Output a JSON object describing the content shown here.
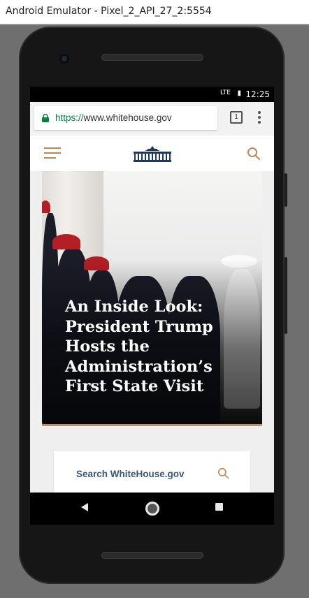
{
  "window": {
    "title": "Android Emulator - Pixel_2_API_27_2:5554"
  },
  "status_bar": {
    "network": "LTE",
    "time": "12:25"
  },
  "browser": {
    "url_scheme": "https://",
    "url_host": "www.whitehouse.gov",
    "tab_count": "1"
  },
  "site": {
    "hero_headline": "An Inside Look: President Trump Hosts the Administration’s First State Visit",
    "search_label": "Search WhiteHouse.gov"
  },
  "colors": {
    "accent_gold": "#b88b5a",
    "link_blue": "#39587a",
    "secure_green": "#0b8043"
  },
  "icons": [
    "lock-icon",
    "menu-icon",
    "white-house-logo-icon",
    "search-icon",
    "back-icon",
    "home-icon",
    "recents-icon"
  ]
}
